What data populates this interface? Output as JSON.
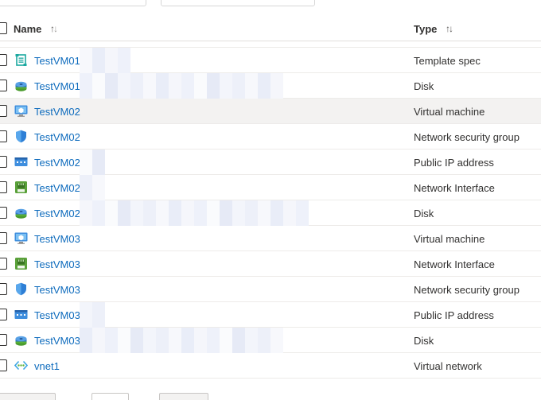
{
  "header": {
    "name_label": "Name",
    "type_label": "Type",
    "sort_up": "↑",
    "sort_down": "↓"
  },
  "colors": {
    "link": "#0f6cbd",
    "row_highlight": "#f3f2f1",
    "divider": "#edebe9"
  },
  "rows": [
    {
      "name": "TestVM01-",
      "type": "Template spec",
      "icon": "template-spec-icon"
    },
    {
      "name": "TestVM01_",
      "type": "Disk",
      "icon": "disk-icon"
    },
    {
      "name": "TestVM02",
      "type": "Virtual machine",
      "icon": "virtual-machine-icon"
    },
    {
      "name": "TestVM02",
      "type": "Network security group",
      "icon": "network-security-group-icon"
    },
    {
      "name": "TestVM02-",
      "type": "Public IP address",
      "icon": "public-ip-icon"
    },
    {
      "name": "TestVM02-",
      "type": "Network Interface",
      "icon": "network-interface-icon"
    },
    {
      "name": "TestVM02_",
      "type": "Disk",
      "icon": "disk-icon"
    },
    {
      "name": "TestVM03",
      "type": "Virtual machine",
      "icon": "virtual-machine-icon"
    },
    {
      "name": "TestVM03",
      "type": "Network Interface",
      "icon": "network-interface-icon"
    },
    {
      "name": "TestVM03",
      "type": "Network security group",
      "icon": "network-security-group-icon"
    },
    {
      "name": "TestVM03-",
      "type": "Public IP address",
      "icon": "public-ip-icon"
    },
    {
      "name": "TestVM03_",
      "type": "Disk",
      "icon": "disk-icon"
    },
    {
      "name": "vnet1",
      "type": "Virtual network",
      "icon": "virtual-network-icon"
    }
  ]
}
